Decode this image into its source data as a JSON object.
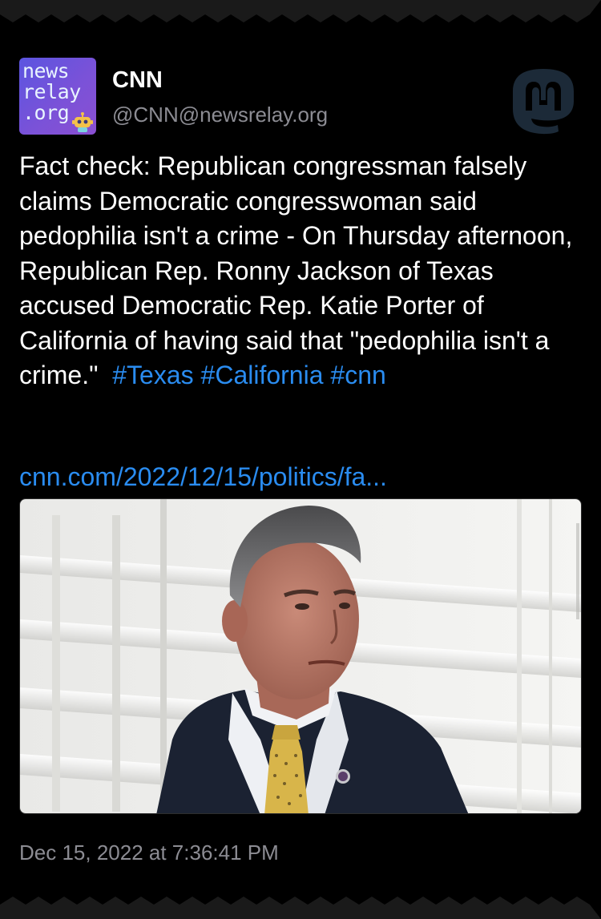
{
  "post": {
    "author": {
      "display_name": "CNN",
      "handle": "@CNN@newsrelay.org",
      "avatar_text": "news\nrelay\n.org"
    },
    "body": "Fact check: Republican congressman falsely claims Democratic congresswoman said pedophilia isn't a crime - On Thursday afternoon, Republican Rep. Ronny Jackson of Texas accused Democratic Rep. Katie Porter of California of having said that \"pedophilia isn't a crime.\"",
    "hashtags": [
      "#Texas",
      "#California",
      "#cnn"
    ],
    "link": "cnn.com/2022/12/15/politics/fa...",
    "timestamp": "Dec 15, 2022 at 7:36:41 PM",
    "image_icon": "photo-of-man-in-suit"
  },
  "icons": {
    "mastodon_logo": "mastodon-logo-icon",
    "avatar_robot": "robot-icon"
  },
  "colors": {
    "background": "#000000",
    "text": "#ffffff",
    "link": "#2a8cf0",
    "muted": "#8c8c93",
    "avatar": "#6a54dc"
  }
}
